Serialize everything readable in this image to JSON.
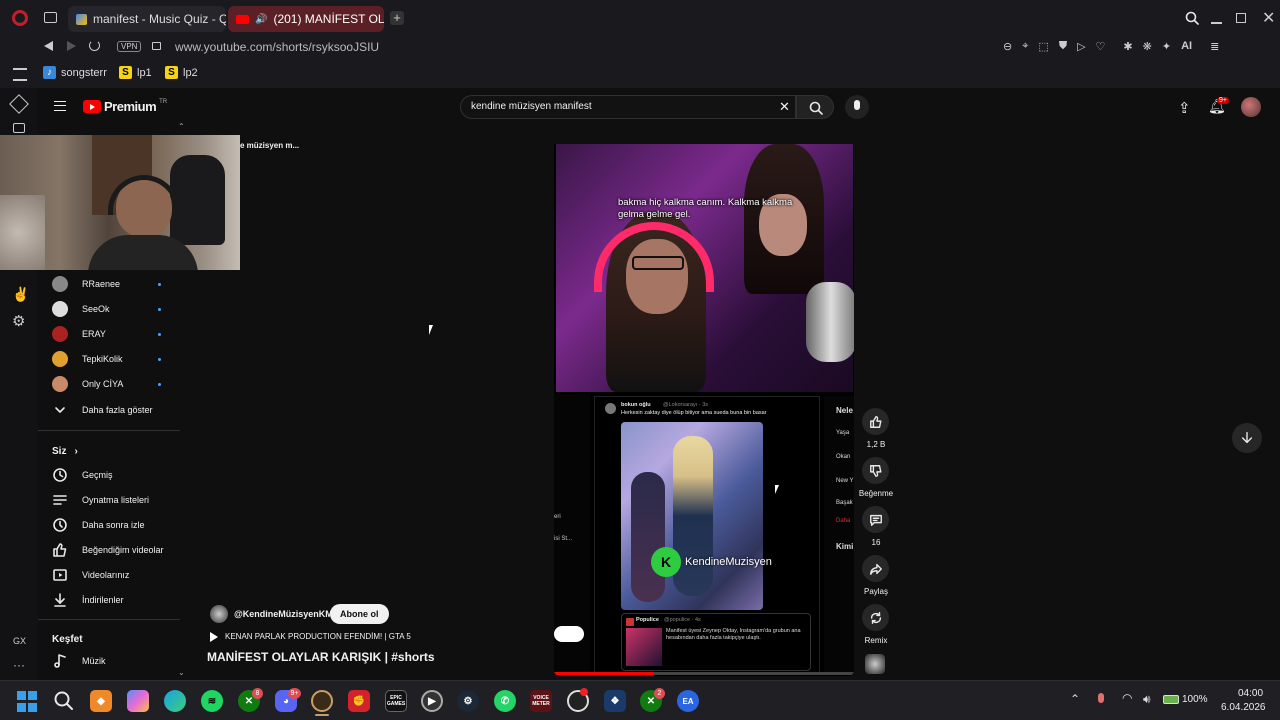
{
  "browser": {
    "tabs": [
      {
        "title": "manifest - Music Quiz - Qu"
      },
      {
        "title": "(201) MANİFEST OLAY"
      }
    ],
    "url": "www.youtube.com/shorts/rsyksooJSIU",
    "vpn_label": "VPN",
    "extension_label": "AI",
    "bookmarks": [
      {
        "label": "songsterr"
      },
      {
        "label": "lp1",
        "glyph": "S"
      },
      {
        "label": "lp2",
        "glyph": "S"
      }
    ]
  },
  "youtube": {
    "logo_text": "Premium",
    "region": "TR",
    "search_value": "kendine müzisyen manifest",
    "notification_badge": "9+",
    "overlay_truncated_text": "e müzisyen m...",
    "subscriptions": [
      {
        "name": "RRaenee",
        "color": "#888888"
      },
      {
        "name": "SeeOk",
        "color": "#dddddd"
      },
      {
        "name": "ERAY",
        "color": "#aa2222"
      },
      {
        "name": "TepkiKolik",
        "color": "#e0a030"
      },
      {
        "name": "Only CİYA",
        "color": "#c98a6a"
      }
    ],
    "show_more": "Daha fazla göster",
    "you_section": {
      "title": "Siz",
      "items": [
        {
          "label": "Geçmiş",
          "icon": "history-icon"
        },
        {
          "label": "Oynatma listeleri",
          "icon": "playlist-icon"
        },
        {
          "label": "Daha sonra izle",
          "icon": "watch-later-icon"
        },
        {
          "label": "Beğendiğim videolar",
          "icon": "like-icon"
        },
        {
          "label": "Videolarınız",
          "icon": "your-videos-icon"
        },
        {
          "label": "İndirilenler",
          "icon": "download-icon"
        }
      ]
    },
    "explore_section": {
      "title": "Keşfet",
      "items": [
        {
          "label": "Müzik",
          "icon": "music-icon"
        }
      ]
    },
    "short": {
      "channel": "@KendineMüzisyenKM",
      "subscribe_label": "Abone ol",
      "music_line": "KENAN PARLAK PRODUCTION EFENDİM! | GTA 5",
      "title": "MANİFEST OLAYLAR KARIŞIK | #shorts",
      "caption": "bakma hiç kalkma canım. Kalkma kalkma gelma gelme gel.",
      "watermark": "KendineMuzisyen",
      "tweet_user": "bokun oğlu",
      "tweet_handle": "@Lokorsarayı · 3s",
      "tweet_text": "Herkesin zaktay diye ölüp bitiyor ama sueda buna bin basar",
      "quote_user": "Populice",
      "quote_handle": "@populice · 4s",
      "quote_text": "Manifest üyesi Zeynep Oktay, Instagram'da grubun ana hesabından daha fazla takipçiye ulaştı.",
      "side_snippets": [
        "Nele",
        "Yaşa",
        "Okan",
        "New Y",
        "Başak",
        "Daha",
        "Kimi"
      ],
      "left_snippets": [
        "eri",
        "isi St..."
      ],
      "progress": 0.33
    },
    "actions": {
      "likes": "1,2 B",
      "dislike_label": "Beğenme",
      "comments": "16",
      "share_label": "Paylaş",
      "remix_label": "Remix"
    }
  },
  "gx_sidebar": {
    "label": "GX"
  },
  "taskbar": {
    "battery": "100%",
    "time": "04:00",
    "date": "6.04.2026",
    "badges": {
      "xbox": "8",
      "discord": "9+",
      "ea": "2"
    },
    "voicemeter": "VOICE METER",
    "epic": "EPIC GAMES"
  }
}
